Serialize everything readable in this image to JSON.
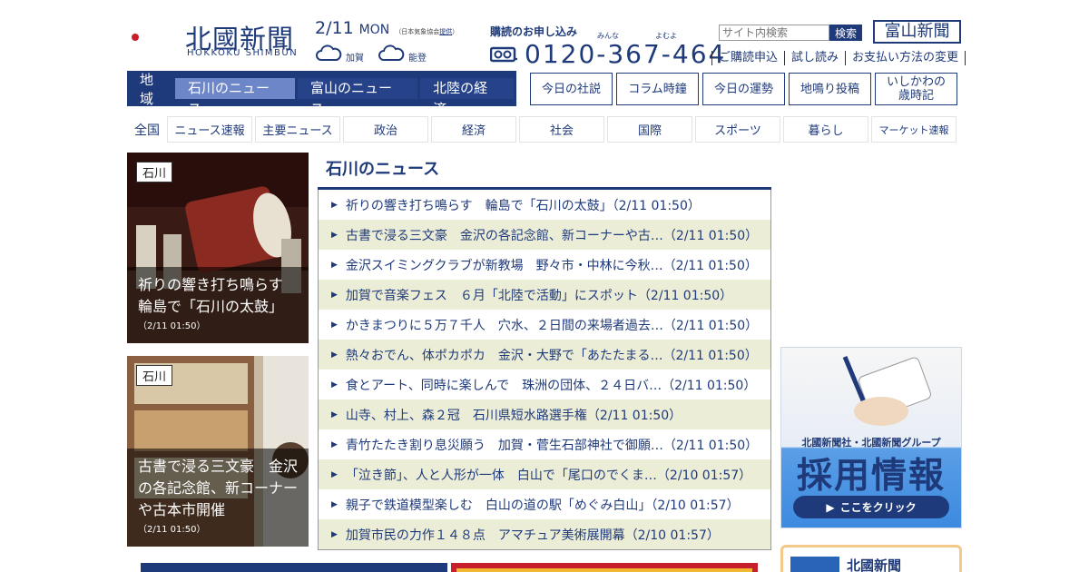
{
  "header": {
    "logo_text": "北國新聞",
    "logo_sub": "HOKKOKU SHIMBUN",
    "date": "2/11",
    "dow": "MON",
    "weather_source_prefix": "（日本気象協会",
    "weather_source_link": "提供",
    "weather_source_suffix": "）",
    "weather": [
      {
        "label": "加賀",
        "icon": "cloud-icon"
      },
      {
        "label": "能登",
        "icon": "cloud-icon"
      }
    ],
    "subscribe_label": "購読のお申し込み",
    "ruby_1": "みんな",
    "ruby_2": "よむよ",
    "phone": "0120-367-464",
    "search_placeholder": "サイト内検索",
    "search_button": "検索",
    "toyama_logo": "富山新聞",
    "toplinks": [
      "ご購読申込",
      "試し読み",
      "お支払い方法の変更"
    ]
  },
  "region": {
    "label": "地域",
    "tabs": [
      {
        "label": "石川のニュース",
        "active": true
      },
      {
        "label": "富山のニュース",
        "active": false
      },
      {
        "label": "北陸の経済",
        "active": false
      }
    ]
  },
  "boxlinks": [
    "今日の社説",
    "コラム時鐘",
    "今日の運勢",
    "地鳴り投稿",
    "いしかわの\n歳時記"
  ],
  "categories": {
    "all": "全国",
    "items": [
      "ニュース速報",
      "主要ニュース",
      "政治",
      "経済",
      "社会",
      "国際",
      "スポーツ",
      "暮らし",
      "マーケット速報"
    ]
  },
  "photos": [
    {
      "tag": "石川",
      "caption": "祈りの響き打ち鳴らす　輪島で「石川の太鼓」",
      "time": "（2/11 01:50）"
    },
    {
      "tag": "石川",
      "caption": "古書で浸る三文豪　金沢の各記念館、新コーナーや古本市開催",
      "time": "（2/11 01:50）"
    }
  ],
  "news": {
    "title": "石川のニュース",
    "items": [
      "祈りの響き打ち鳴らす　輪島で「石川の太鼓」（2/11 01:50）",
      "古書で浸る三文豪　金沢の各記念館、新コーナーや古…（2/11 01:50）",
      "金沢スイミングクラブが新教場　野々市・中林に今秋…（2/11 01:50）",
      "加賀で音楽フェス　６月「北陸で活動」にスポット（2/11 01:50）",
      "かきまつりに５万７千人　穴水、２日間の来場者過去…（2/11 01:50）",
      "熱々おでん、体ポカポカ　金沢・大野で「あたたまる…（2/11 01:50）",
      "食とアート、同時に楽しんで　珠洲の団体、２４日バ…（2/11 01:50）",
      "山寺、村上、森２冠　石川県短水路選手権（2/11 01:50）",
      "青竹たたき割り息災願う　加賀・菅生石部神社で御願…（2/11 01:50）",
      "「泣き節」、人と人形が一体　白山で「尾口のでくま…（2/10 01:57）",
      "親子で鉄道模型楽しむ　白山の道の駅「めぐみ白山」（2/10 01:57）",
      "加賀市民の力作１４８点　アマチュア美術展開幕（2/10 01:57）"
    ]
  },
  "ad": {
    "line1": "北國新聞社・北國新聞グループ",
    "line2": "採用情報",
    "button": "ここをクリック"
  },
  "promo": {
    "title": "北國新聞"
  },
  "colors": {
    "brand": "#1f3a7a",
    "active_tab": "#6d86c7",
    "row_alt": "#ecedd7"
  }
}
